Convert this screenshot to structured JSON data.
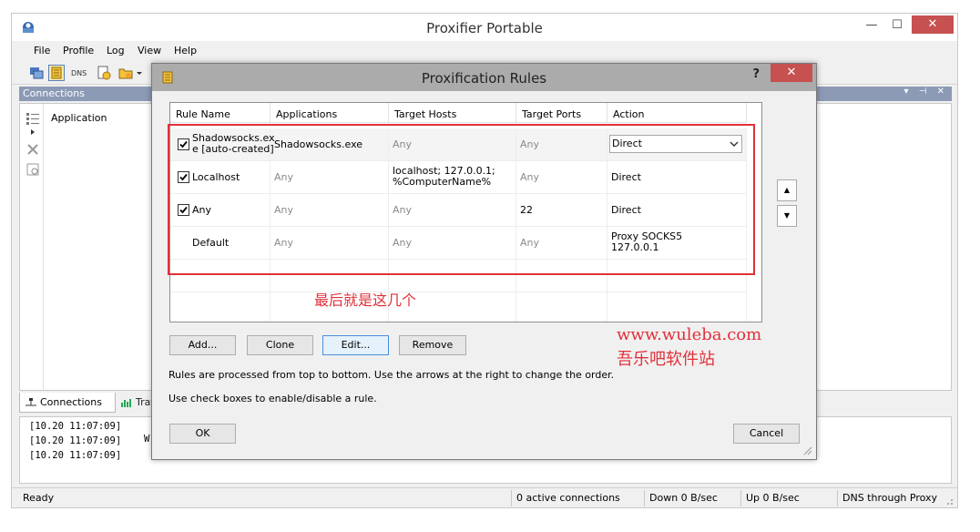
{
  "main_window": {
    "title": "Proxifier Portable",
    "minimize_glyph": "—",
    "maximize_glyph": "☐",
    "close_glyph": "✕"
  },
  "menu": [
    "File",
    "Profile",
    "Log",
    "View",
    "Help"
  ],
  "connections_panel": {
    "header": "Connections",
    "header_buttons": "▾ ⊣ ✕",
    "column_application": "Application"
  },
  "tabs": {
    "connections": "Connections",
    "traffic": "Traffi"
  },
  "log": {
    "lines": [
      "[10.20 11:07:09]",
      "[10.20 11:07:09]",
      "[10.20 11:07:09]"
    ],
    "partial": "W"
  },
  "status": {
    "ready": "Ready",
    "active_connections": "0 active connections",
    "down": "Down 0 B/sec",
    "up": "Up 0 B/sec",
    "dns": "DNS through Proxy"
  },
  "dialog": {
    "title": "Proxification Rules",
    "help_glyph": "?",
    "close_glyph": "✕",
    "columns": {
      "rule_name": "Rule Name",
      "applications": "Applications",
      "target_hosts": "Target Hosts",
      "target_ports": "Target Ports",
      "action": "Action"
    },
    "rules": [
      {
        "name_line1": "Shadowsocks.ex",
        "name_line2": "e [auto-created]",
        "applications": "Shadowsocks.exe",
        "hosts": "Any",
        "ports": "Any",
        "action": "Direct",
        "checked": true
      },
      {
        "name": "Localhost",
        "applications": "Any",
        "hosts_line1": "localhost; 127.0.0.1;",
        "hosts_line2": "%ComputerName%",
        "ports": "Any",
        "action": "Direct",
        "checked": true
      },
      {
        "name": "Any",
        "applications": "Any",
        "hosts": "Any",
        "ports": "22",
        "action": "Direct",
        "checked": true
      },
      {
        "name": "Default",
        "applications": "Any",
        "hosts": "Any",
        "ports": "Any",
        "action_line1": "Proxy SOCKS5",
        "action_line2": "127.0.0.1",
        "checked": false
      }
    ],
    "buttons": {
      "add": "Add...",
      "clone": "Clone",
      "edit": "Edit...",
      "remove": "Remove",
      "ok": "OK",
      "cancel": "Cancel",
      "move_up": "▲",
      "move_down": "▼"
    },
    "note1": "Rules are processed from top to bottom. Use the arrows at the right to change the order.",
    "note2": "Use check boxes to enable/disable a rule."
  },
  "annotations": {
    "chinese_note": "最后就是这几个",
    "url": "www.wuleba.com",
    "site_name": "吾乐吧软件站"
  },
  "colors": {
    "annotation_red": "#e0303a",
    "close_red": "#c75050",
    "connections_header": "#8c9ab6"
  }
}
